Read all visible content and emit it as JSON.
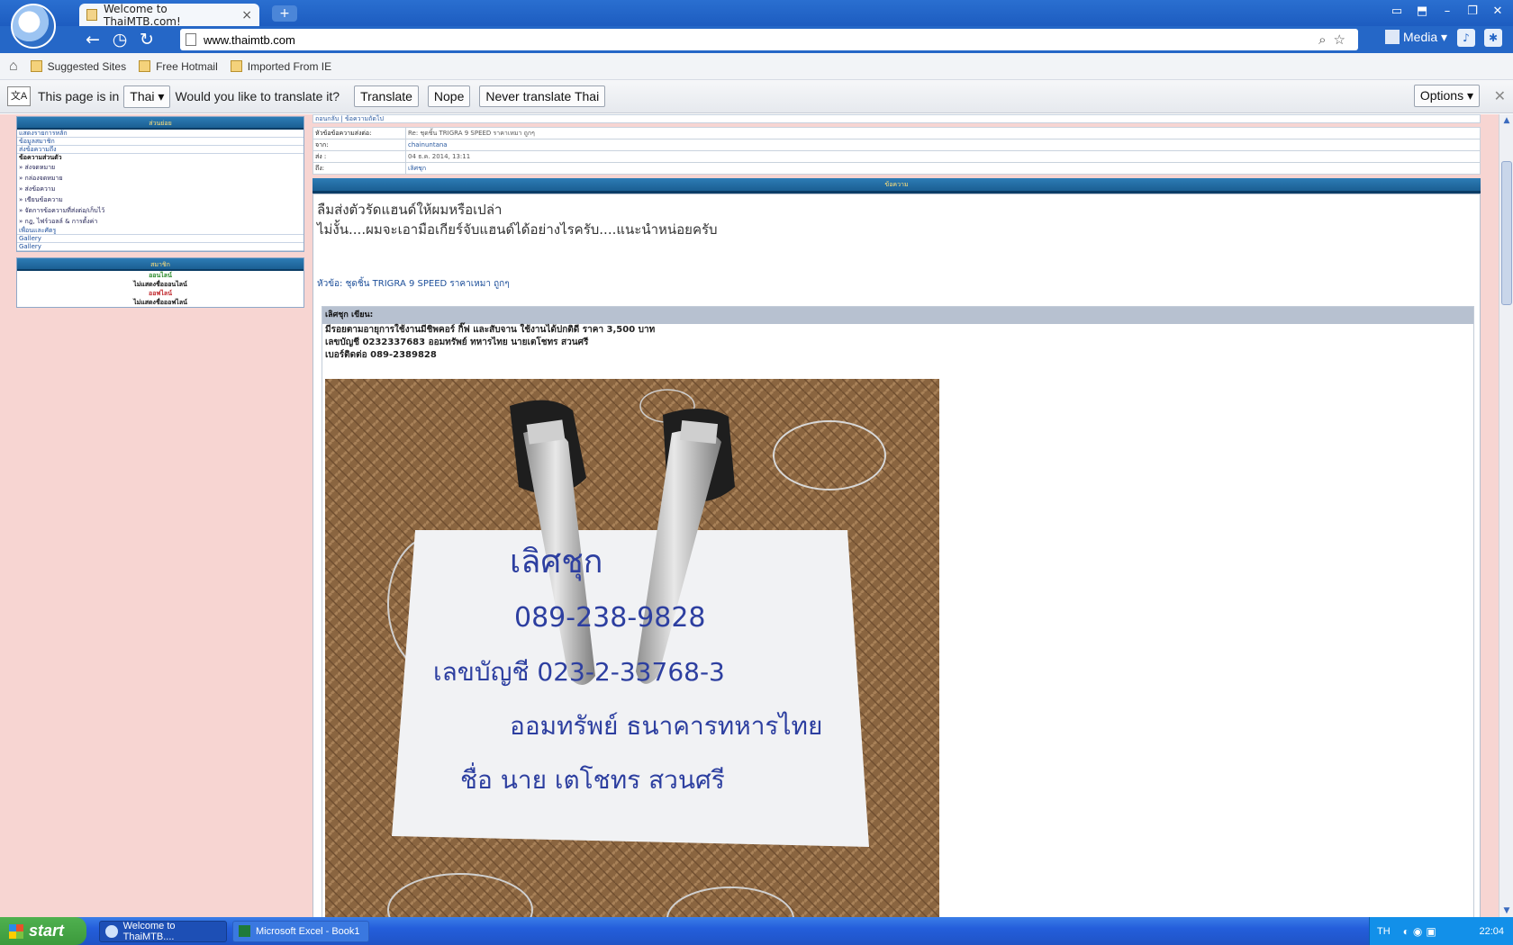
{
  "browser": {
    "tab_title": "Welcome to ThaiMTB.com!",
    "tab_close": "×",
    "new_tab": "+",
    "url": "www.thaimtb.com",
    "media_label": "Media ▾",
    "window_controls": [
      "▭",
      "⬒",
      "–",
      "❐",
      "✕"
    ],
    "bookmarks": [
      "Suggested Sites",
      "Free Hotmail",
      "Imported From IE"
    ]
  },
  "translate_bar": {
    "prefix": "This page is in",
    "language": "Thai ▾",
    "question": "Would you like to translate it?",
    "translate_btn": "Translate",
    "nope_btn": "Nope",
    "never_btn": "Never translate Thai",
    "options_btn": "Options ▾",
    "close": "✕"
  },
  "sidebar": {
    "menu_header": "ส่วนย่อย",
    "menu_items": [
      "แสดงรายการหลัก",
      "ข้อมูลสมาชิก",
      "ส่งข้อความถึง"
    ],
    "messages_title": "ข้อความส่วนตัว",
    "message_links": [
      "» ส่งจดหมาย",
      "» กล่องจดหมาย",
      "» ส่งข้อความ",
      "» เขียนข้อความ",
      "» จัดการข้อความที่ส่งต่อ/เก็บไว้",
      "» กฎ, ไฟร์วอลล์ & การตั้งค่า"
    ],
    "extra_items": [
      "เพื่อนและศัตรู",
      "Gallery",
      "Gallery"
    ],
    "members_header": "สมาชิก",
    "members": [
      {
        "text": "ออนไลน์",
        "tone": "green"
      },
      {
        "text": "ไม่แสดงชื่อออนไลน์",
        "tone": "black"
      },
      {
        "text": "ออฟไลน์",
        "tone": "red"
      },
      {
        "text": "ไม่แสดงชื่อออฟไลน์",
        "tone": "black"
      }
    ]
  },
  "post": {
    "breadcrumb": "ถอนกลับ | ข้อความถัดไป",
    "header_rows": [
      {
        "key": "หัวข้อข้อความส่งต่อ:",
        "value": "Re: ชุดชิ้น TRIGRA 9 SPEED ราคาเหมา ถูกๆ"
      },
      {
        "key": "จาก:",
        "value": "chainuntana"
      },
      {
        "key": "ส่ง :",
        "value": "04 ธ.ค. 2014, 13:11"
      },
      {
        "key": "ถึง:",
        "value": "เลิศชุก"
      }
    ],
    "section_title": "ข้อความ",
    "message_line1": "ลืมส่งตัวรัดแฮนด์ให้ผมหรือเปล่า",
    "message_line2": "ไม่งั้น....ผมจะเอามือเกียร์จับแฮนด์ได้อย่างไรครับ....แนะนำหน่อยครับ",
    "subject": "หัวข้อ: ชุดชิ้น TRIGRA 9 SPEED ราคาเหมา ถูกๆ",
    "quote_header": "เลิศชุก เขียน:",
    "quote_lines": [
      "มีรอยตามอายุการใช้งานมีชิพคอร์ กิ๊ฟ และสับจาน ใช้งานได้ปกติดี ราคา 3,500 บาท",
      "เลขบัญชี 0232337683 ออมทรัพย์ ทหารไทย นายเตโชทร สวนศรี",
      "เบอร์ติดต่อ 089-2389828"
    ],
    "photo_note_lines": [
      "เลิศชุก",
      "089-238-9828",
      "เลขบัญชี 023-2-33768-3",
      "ออมทรัพย์ ธนาคารทหารไทย",
      "ชื่อ นาย เตโชทร สวนศรี"
    ]
  },
  "taskbar": {
    "start": "start",
    "tasks": [
      "Welcome to ThaiMTB....",
      "Microsoft Excel - Book1"
    ],
    "lang": "TH",
    "clock": "22:04"
  },
  "colors": {
    "page_bg": "#f7d5d2",
    "header_blue": "#1b5f93",
    "chrome_blue": "#2567c7",
    "taskbar_blue": "#245edb",
    "start_green": "#3c9a3c"
  }
}
